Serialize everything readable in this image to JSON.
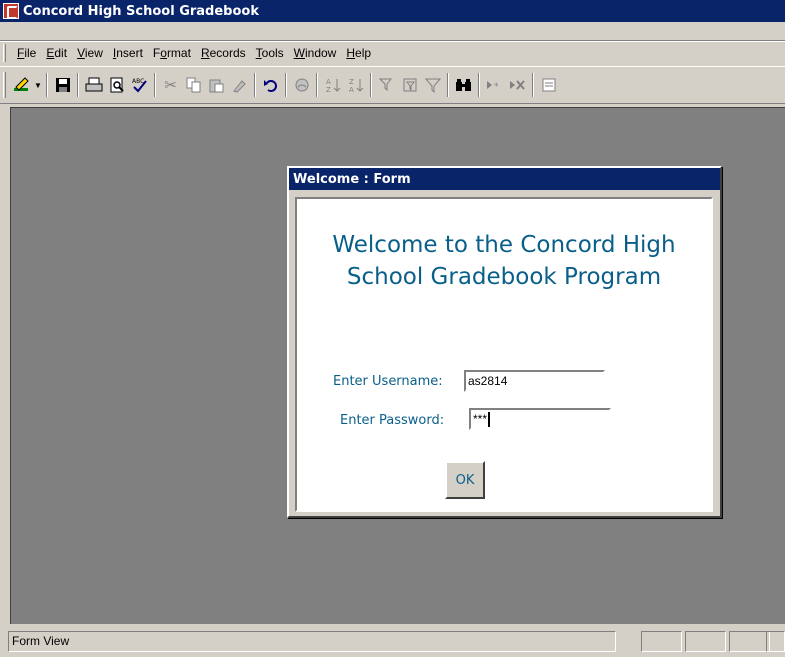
{
  "window": {
    "title": "Concord High School Gradebook",
    "app_icon": "access-icon"
  },
  "menu": [
    {
      "pre": "",
      "u": "F",
      "post": "ile"
    },
    {
      "pre": "",
      "u": "E",
      "post": "dit"
    },
    {
      "pre": "",
      "u": "V",
      "post": "iew"
    },
    {
      "pre": "",
      "u": "I",
      "post": "nsert"
    },
    {
      "pre": "F",
      "u": "o",
      "post": "rmat"
    },
    {
      "pre": "",
      "u": "R",
      "post": "ecords"
    },
    {
      "pre": "",
      "u": "T",
      "post": "ools"
    },
    {
      "pre": "",
      "u": "W",
      "post": "indow"
    },
    {
      "pre": "",
      "u": "H",
      "post": "elp"
    }
  ],
  "toolbar": {
    "icons": [
      "view-design-icon",
      "save-icon",
      "print-icon",
      "print-preview-icon",
      "spelling-icon",
      "cut-icon",
      "copy-icon",
      "paste-icon",
      "format-painter-icon",
      "undo-icon",
      "insert-hyperlink-icon",
      "sort-ascending-icon",
      "sort-descending-icon",
      "filter-by-selection-icon",
      "filter-by-form-icon",
      "apply-filter-icon",
      "find-icon",
      "new-record-icon",
      "delete-record-icon",
      "properties-icon"
    ]
  },
  "dialog": {
    "title": "Welcome : Form",
    "heading_line1": "Welcome to the Concord High",
    "heading_line2": "School Gradebook Program",
    "username_label": "Enter Username:",
    "username_value": "as2814",
    "password_label": "Enter Password:",
    "password_value": "***",
    "ok_label": "OK"
  },
  "status": {
    "text": "Form View"
  },
  "colors": {
    "titlebar": "#0a246a",
    "accent_text": "#0a5f8a",
    "workspace": "#808080",
    "chrome": "#d4d0c8"
  }
}
